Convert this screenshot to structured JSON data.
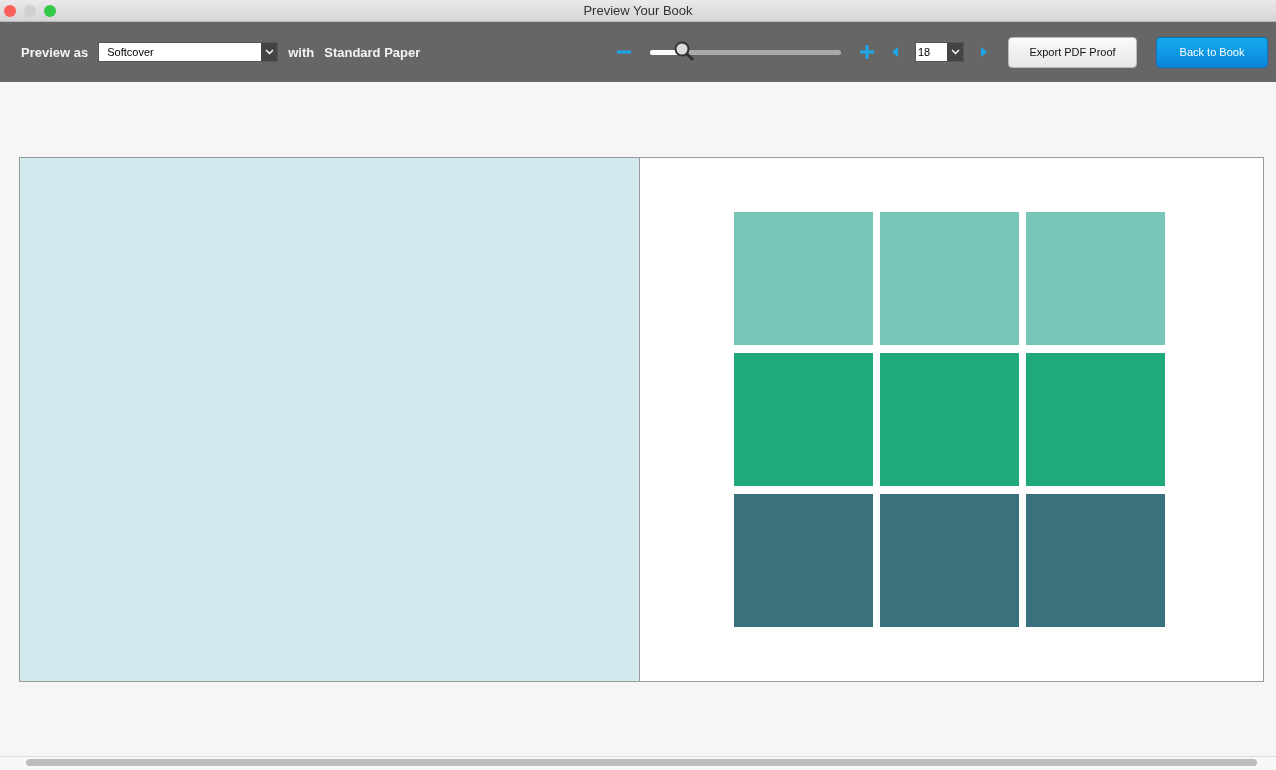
{
  "window": {
    "title": "Preview Your Book"
  },
  "toolbar": {
    "preview_label": "Preview as",
    "format_value": "Softcover",
    "with_label": "with",
    "paper_label": "Standard Paper",
    "zoom": {
      "level": 0.17
    },
    "page_value": "18",
    "export_button": "Export PDF Proof",
    "back_button": "Back to Book"
  },
  "spread": {
    "left_page": {
      "color": "#d2e9ee"
    },
    "right_page": {
      "tiles": [
        {
          "color": "#78c6ba"
        },
        {
          "color": "#78c6ba"
        },
        {
          "color": "#78c6ba"
        },
        {
          "color": "#1eaa7b"
        },
        {
          "color": "#1eaa7b"
        },
        {
          "color": "#1eaa7b"
        },
        {
          "color": "#39717d"
        },
        {
          "color": "#39717d"
        },
        {
          "color": "#39717d"
        }
      ]
    }
  }
}
